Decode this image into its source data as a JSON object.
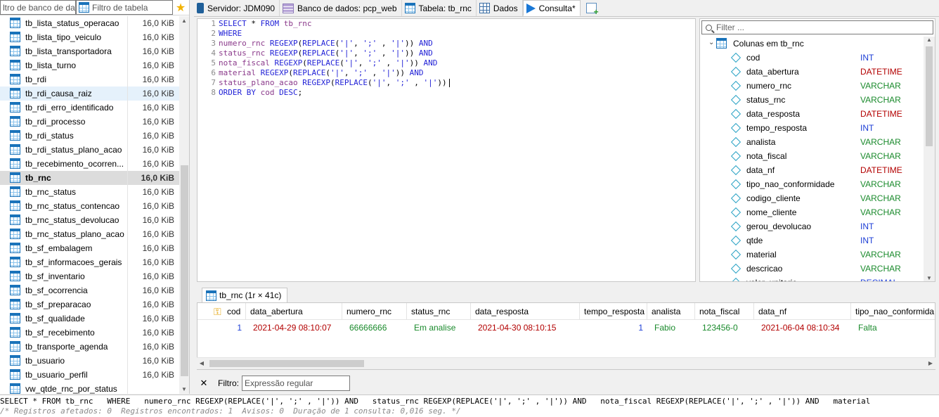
{
  "left": {
    "db_filter_placeholder": "ltro de banco de dad",
    "table_filter_placeholder": "Filtro de tabela",
    "tables": [
      {
        "name": "tb_lista_status_operacao",
        "size": "16,0 KiB"
      },
      {
        "name": "tb_lista_tipo_veiculo",
        "size": "16,0 KiB"
      },
      {
        "name": "tb_lista_transportadora",
        "size": "16,0 KiB"
      },
      {
        "name": "tb_lista_turno",
        "size": "16,0 KiB"
      },
      {
        "name": "tb_rdi",
        "size": "16,0 KiB"
      },
      {
        "name": "tb_rdi_causa_raiz",
        "size": "16,0 KiB"
      },
      {
        "name": "tb_rdi_erro_identificado",
        "size": "16,0 KiB"
      },
      {
        "name": "tb_rdi_processo",
        "size": "16,0 KiB"
      },
      {
        "name": "tb_rdi_status",
        "size": "16,0 KiB"
      },
      {
        "name": "tb_rdi_status_plano_acao",
        "size": "16,0 KiB"
      },
      {
        "name": "tb_recebimento_ocorren...",
        "size": "16,0 KiB"
      },
      {
        "name": "tb_rnc",
        "size": "16,0 KiB"
      },
      {
        "name": "tb_rnc_status",
        "size": "16,0 KiB"
      },
      {
        "name": "tb_rnc_status_contencao",
        "size": "16,0 KiB"
      },
      {
        "name": "tb_rnc_status_devolucao",
        "size": "16,0 KiB"
      },
      {
        "name": "tb_rnc_status_plano_acao",
        "size": "16,0 KiB"
      },
      {
        "name": "tb_sf_embalagem",
        "size": "16,0 KiB"
      },
      {
        "name": "tb_sf_informacoes_gerais",
        "size": "16,0 KiB"
      },
      {
        "name": "tb_sf_inventario",
        "size": "16,0 KiB"
      },
      {
        "name": "tb_sf_ocorrencia",
        "size": "16,0 KiB"
      },
      {
        "name": "tb_sf_preparacao",
        "size": "16,0 KiB"
      },
      {
        "name": "tb_sf_qualidade",
        "size": "16,0 KiB"
      },
      {
        "name": "tb_sf_recebimento",
        "size": "16,0 KiB"
      },
      {
        "name": "tb_transporte_agenda",
        "size": "16,0 KiB"
      },
      {
        "name": "tb_usuario",
        "size": "16,0 KiB"
      },
      {
        "name": "tb_usuario_perfil",
        "size": "16,0 KiB"
      },
      {
        "name": "vw_qtde_rnc_por_status",
        "size": ""
      }
    ]
  },
  "tabs": {
    "server": "Servidor: JDM090",
    "database": "Banco de dados: pcp_web",
    "table": "Tabela: tb_rnc",
    "data": "Dados",
    "query": "Consulta*"
  },
  "editor": {
    "line_numbers": [
      "1",
      "2",
      "3",
      "4",
      "5",
      "6",
      "7",
      "8"
    ]
  },
  "columns_panel": {
    "filter_placeholder": "Filter ...",
    "root_label": "Colunas em tb_rnc",
    "columns": [
      {
        "name": "cod",
        "type": "INT"
      },
      {
        "name": "data_abertura",
        "type": "DATETIME"
      },
      {
        "name": "numero_rnc",
        "type": "VARCHAR"
      },
      {
        "name": "status_rnc",
        "type": "VARCHAR"
      },
      {
        "name": "data_resposta",
        "type": "DATETIME"
      },
      {
        "name": "tempo_resposta",
        "type": "INT"
      },
      {
        "name": "analista",
        "type": "VARCHAR"
      },
      {
        "name": "nota_fiscal",
        "type": "VARCHAR"
      },
      {
        "name": "data_nf",
        "type": "DATETIME"
      },
      {
        "name": "tipo_nao_conformidade",
        "type": "VARCHAR"
      },
      {
        "name": "codigo_cliente",
        "type": "VARCHAR"
      },
      {
        "name": "nome_cliente",
        "type": "VARCHAR"
      },
      {
        "name": "gerou_devolucao",
        "type": "INT"
      },
      {
        "name": "qtde",
        "type": "INT"
      },
      {
        "name": "material",
        "type": "VARCHAR"
      },
      {
        "name": "descricao",
        "type": "VARCHAR"
      },
      {
        "name": "valor_unitario",
        "type": "DECIMAL"
      }
    ]
  },
  "results": {
    "tab_label": "tb_rnc (1r × 41c)",
    "headers": [
      "cod",
      "data_abertura",
      "numero_rnc",
      "status_rnc",
      "data_resposta",
      "tempo_resposta",
      "analista",
      "nota_fiscal",
      "data_nf",
      "tipo_nao_conformida"
    ],
    "row": [
      "1",
      "2021-04-29 08:10:07",
      "66666666",
      "Em analise",
      "2021-04-30 08:10:15",
      "1",
      "Fabio",
      "123456-0",
      "2021-06-04 08:10:34",
      "Falta"
    ]
  },
  "filterbar": {
    "label": "Filtro:",
    "placeholder": "Expressão regular"
  },
  "log": {
    "line1": "SELECT * FROM tb_rnc   WHERE   numero_rnc REGEXP(REPLACE('|', ';' , '|')) AND   status_rnc REGEXP(REPLACE('|', ';' , '|')) AND   nota_fiscal REGEXP(REPLACE('|', ';' , '|')) AND   material",
    "line2": "/* Registros afetados: 0  Registros encontrados: 1  Avisos: 0  Duração de 1 consulta: 0,016 seg. */"
  }
}
